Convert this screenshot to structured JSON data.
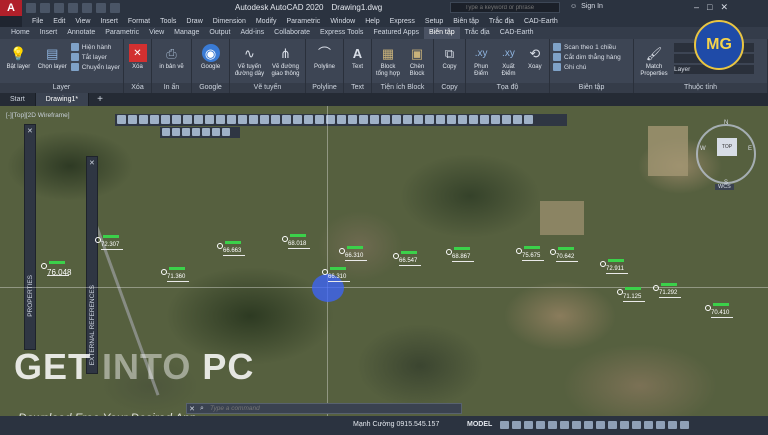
{
  "titlebar": {
    "app": "A",
    "product": "Autodesk AutoCAD 2020",
    "file": "Drawing1.dwg",
    "search_placeholder": "Type a keyword or phrase",
    "signin": "Sign In"
  },
  "menu": [
    "File",
    "Edit",
    "View",
    "Insert",
    "Format",
    "Tools",
    "Draw",
    "Dimension",
    "Modify",
    "Parametric",
    "Window",
    "Help",
    "Express",
    "Setup",
    "Biên tập",
    "Trắc địa",
    "CAD-Earth"
  ],
  "ribbon_tabs": [
    "Home",
    "Insert",
    "Annotate",
    "Parametric",
    "View",
    "Manage",
    "Output",
    "Add-ins",
    "Collaborate",
    "Express Tools",
    "Featured Apps",
    "Biên tập",
    "Trắc địa",
    "CAD-Earth"
  ],
  "ribbon_active": "Biên tập",
  "ribbon": {
    "layer": {
      "title": "Layer",
      "b1": "Bật layer",
      "b2": "Chọn layer",
      "s1": "Hiện hành",
      "s2": "Tắt layer",
      "s3": "Chuyển layer"
    },
    "xoa": {
      "title": "Xóa",
      "b1": "Xóa"
    },
    "inan": {
      "title": "In ấn",
      "b1": "in bản vẽ"
    },
    "google": {
      "title": "Google",
      "b1": "Google"
    },
    "vetuyen": {
      "title": "Vẽ tuyến",
      "b1": "Vẽ tuyến đường dây",
      "b2": "Vẽ đường giao thông"
    },
    "polyline": {
      "title": "Polyline",
      "b1": "Polyline"
    },
    "text": {
      "title": "Text",
      "b1": "Text"
    },
    "block": {
      "title": "Tiện ích Block",
      "b1": "Block tổng hợp",
      "b2": "Chèn Block",
      "b3": "Copy"
    },
    "copy": {
      "title": "Copy"
    },
    "toado": {
      "title": "Tọa độ",
      "b1": "Phun Điểm",
      "b2": "Xuất Điểm"
    },
    "xoay": {
      "b1": "Xoay"
    },
    "bientap": {
      "title": "Biên tập",
      "s1": "Scan theo 1 chiều",
      "s2": "Cắt dim thẳng hàng",
      "s3": "Ghi chú"
    },
    "thuoctinh": {
      "title": "Thuộc tính",
      "b1": "Match Properties",
      "layer": "Layer"
    }
  },
  "doc_tabs": [
    "Start",
    "Drawing1*"
  ],
  "viewport": {
    "label": "[-][Top][2D Wireframe]",
    "nav_top": "TOP",
    "nav_n": "N",
    "nav_s": "S",
    "nav_w": "W",
    "nav_e": "E",
    "wcs": "WCS"
  },
  "palettes": {
    "properties": "PROPERTIES",
    "external_refs": "EXTERNAL REFERENCES"
  },
  "points": [
    "72.307",
    "76.048",
    "66.663",
    "68.018",
    "71.360",
    "66.310",
    "66.547",
    "68.867",
    "66.310",
    "75.675",
    "70.642",
    "72.911",
    "71.125",
    "71.292",
    "70.410"
  ],
  "watermark": {
    "big1": "GET ",
    "big2": "INTO",
    "big3": " PC",
    "small": "Download Free Your Desired App"
  },
  "logo": "MG",
  "command": {
    "placeholder": "Type a command"
  },
  "status": {
    "owner": "Mạnh Cường 0915.545.157",
    "model": "MODEL"
  }
}
